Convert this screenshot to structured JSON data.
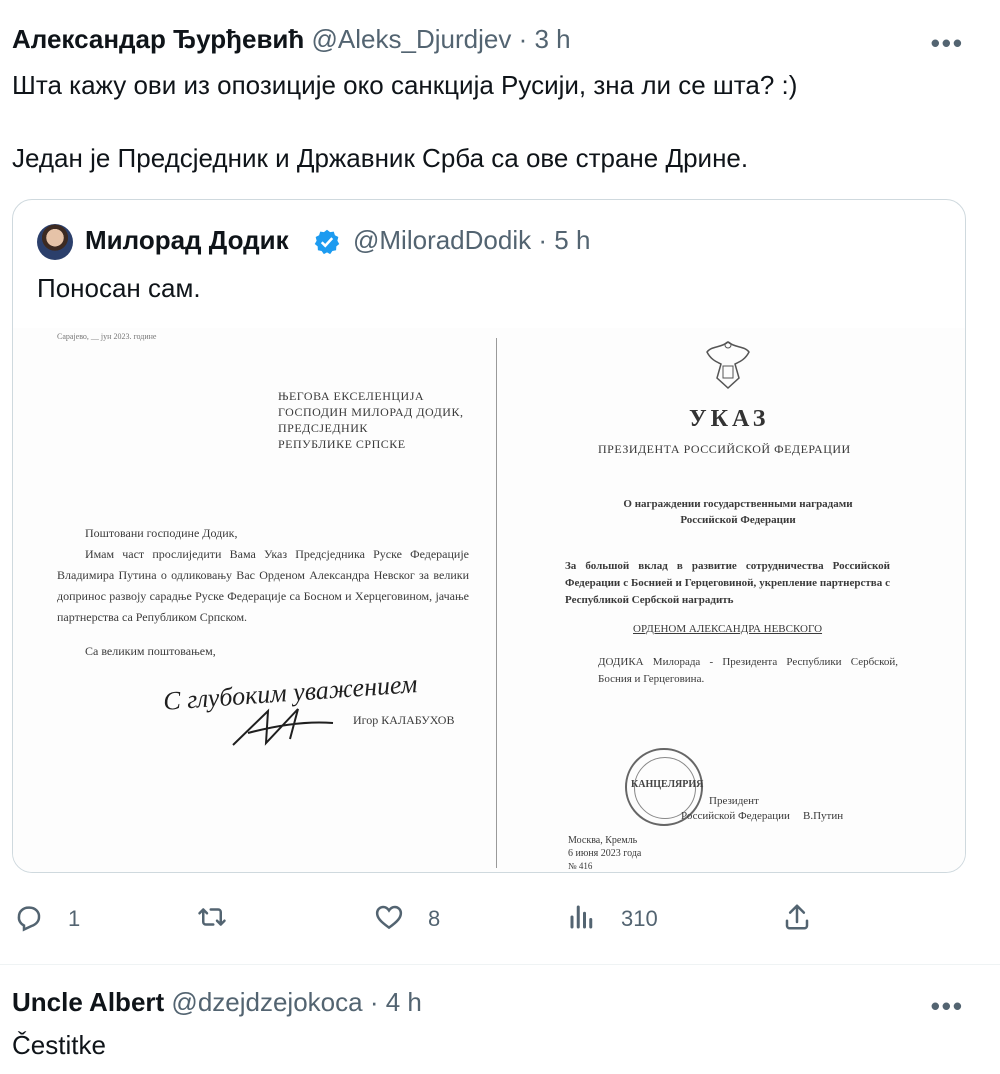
{
  "tweet": {
    "author_name": "Александар Ђурђевић",
    "author_handle": "@Aleks_Djurdjev",
    "separator": "·",
    "time": "3 h",
    "text_line1": "Шта кажу ови из опозиције око санкција Русији, зна ли се шта? :)",
    "text_line2": "Један је Предсједник и Државник Срба са ове стране Дрине."
  },
  "quote": {
    "author_name": "Милорад Додик",
    "author_handle": "@MiloradDodik",
    "separator": "·",
    "time": "5 h",
    "text": "Поносан сам.",
    "verified": true
  },
  "document_left": {
    "date_line": "Сарајево, __ јун 2023. године",
    "addressee": [
      "ЊЕГОВА ЕКСЕЛЕНЦИЈА",
      "ГОСПОДИН МИЛОРАД ДОДИК,",
      "ПРЕДСЈЕДНИК",
      "РЕПУБЛИКЕ СРПСКЕ"
    ],
    "greeting": "Поштовани господине Додик,",
    "body": "Имам част прослиједити Вама Указ Предсједника Руске Федерације Владимира Путина о одликовању Вас Орденом Александра Невског за велики допринос развоју сарадње Руске Федерације са Босном и Херцеговином, јачање партнерства са Републиком Српском.",
    "closing": "Са великим поштовањем,",
    "handwritten": "С глубоким уважением",
    "signatory": "Игор КАЛАБУХОВ"
  },
  "document_right": {
    "title": "УКАЗ",
    "subtitle": "ПРЕЗИДЕНТА РОССИЙСКОЙ ФЕДЕРАЦИИ",
    "heading": "О награждении государственными наградами Российской Федерации",
    "body": "За большой вклад в развитие сотрудничества Российской Федерации с Боснией и Герцеговиной, укрепление партнерства с Республикой Сербской наградить",
    "order": "ОРДЕНОМ АЛЕКСАНДРА НЕВСКОГО",
    "recipient": "ДОДИКА Милорада - Президента Республики Сербской, Босния и Герцеговина.",
    "stamp": "КАНЦЕЛЯРИЯ",
    "sign_role_1": "Президент",
    "sign_role_2": "Российской Федерации",
    "sign_name": "В.Путин",
    "place": "Москва, Кремль",
    "date": "6 июня 2023 года",
    "number": "№ 416"
  },
  "actions": {
    "replies": "1",
    "retweets": "",
    "likes": "8",
    "views": "310"
  },
  "reply": {
    "author_name": "Uncle Albert",
    "author_handle": "@dzejdzejokoca",
    "separator": "·",
    "time": "4 h",
    "text": "Čestitke"
  },
  "colors": {
    "text": "#0f1419",
    "secondary": "#536471",
    "verified": "#1d9bf0",
    "border": "#cfd9de"
  }
}
